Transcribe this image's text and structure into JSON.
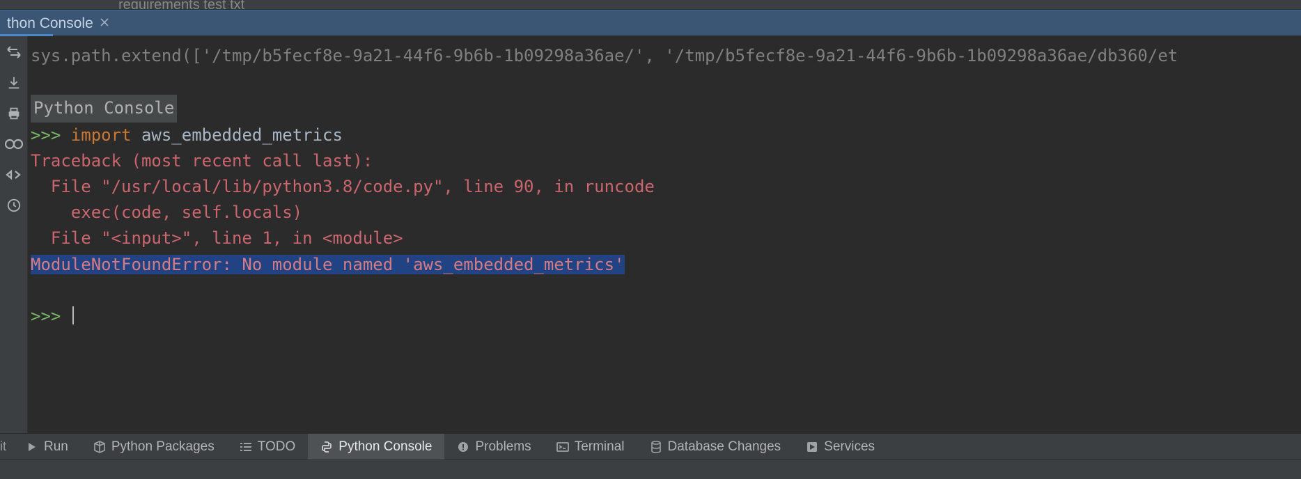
{
  "top_fragment": "requirements test txt",
  "tab": {
    "title": "thon Console"
  },
  "console": {
    "sys_line": "sys.path.extend(['/tmp/b5fecf8e-9a21-44f6-9b6b-1b09298a36ae/', '/tmp/b5fecf8e-9a21-44f6-9b6b-1b09298a36ae/db360/et",
    "label": "Python Console",
    "prompt": ">>> ",
    "import_kw": "import",
    "import_mod": " aws_embedded_metrics",
    "tb1": "Traceback (most recent call last):",
    "tb2": "  File \"/usr/local/lib/python3.8/code.py\", line 90, in runcode",
    "tb3": "    exec(code, self.locals)",
    "tb4": "  File \"<input>\", line 1, in <module>",
    "err": "ModuleNotFoundError: No module named 'aws_embedded_metrics'",
    "prompt2": ">>> "
  },
  "bottom": {
    "git": "it",
    "run": "Run",
    "packages": "Python Packages",
    "todo": "TODO",
    "console": "Python Console",
    "problems": "Problems",
    "terminal": "Terminal",
    "db": "Database Changes",
    "services": "Services"
  }
}
